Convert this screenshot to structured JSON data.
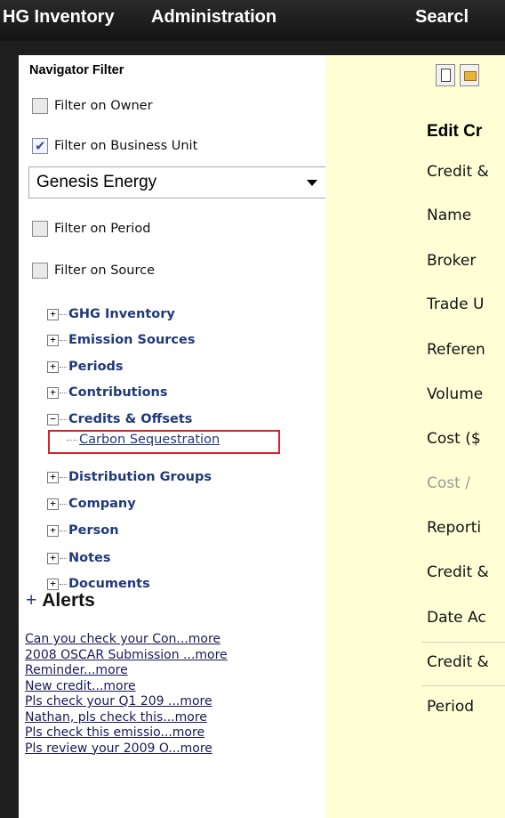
{
  "topnav": [
    "HG Inventory",
    "Administration",
    "Searcl"
  ],
  "navigator_filter": {
    "title": "Navigator Filter",
    "filters": [
      {
        "label": "Filter on Owner",
        "checked": false
      },
      {
        "label": "Filter on Business Unit",
        "checked": true
      },
      {
        "label": "Filter on Period",
        "checked": false
      },
      {
        "label": "Filter on Source",
        "checked": false
      }
    ],
    "business_unit_value": "Genesis Energy"
  },
  "tree": [
    {
      "label": "GHG Inventory",
      "expander": "+"
    },
    {
      "label": "Emission Sources",
      "expander": "+"
    },
    {
      "label": "Periods",
      "expander": "+"
    },
    {
      "label": "Contributions",
      "expander": "+"
    },
    {
      "label": "Credits & Offsets",
      "expander": "−"
    },
    {
      "label": "Carbon Sequestration",
      "child": true
    },
    {
      "label": "Distribution Groups",
      "expander": "+"
    },
    {
      "label": "Company",
      "expander": "+"
    },
    {
      "label": "Person",
      "expander": "+"
    },
    {
      "label": "Notes",
      "expander": "+"
    },
    {
      "label": "Documents",
      "expander": "+"
    }
  ],
  "alerts": {
    "title": "Alerts",
    "plus": "+",
    "items": [
      "Can you check your Con...more",
      "2008 OSCAR Submission ...more",
      "Reminder...more",
      "New credit...more",
      "Pls check your Q1 209 ...more",
      "Nathan, pls check this...more",
      "Pls check this emissio...more",
      "Pls review your 2009 O...more"
    ]
  },
  "edit_panel": {
    "title": "Edit Cr",
    "fields": [
      {
        "label": "Credit &",
        "muted": false
      },
      {
        "label": "Name",
        "muted": false
      },
      {
        "label": "Broker",
        "muted": false
      },
      {
        "label": "Trade U",
        "muted": false
      },
      {
        "label": "Referen",
        "muted": false
      },
      {
        "label": "Volume",
        "muted": false
      },
      {
        "label": "Cost ($",
        "muted": false
      },
      {
        "label": "Cost /",
        "muted": true
      },
      {
        "label": "Reporti",
        "muted": false
      },
      {
        "label": "Credit &",
        "muted": false
      },
      {
        "label": "Date Ac",
        "muted": false
      },
      {
        "label": "Credit &",
        "muted": false
      },
      {
        "label": "Period",
        "muted": false
      }
    ]
  },
  "colors": {
    "topbar": "#1e1e1e",
    "left_panel": "#ffffff",
    "right_panel": "#ffffd6",
    "tree_link": "#1f3a7a",
    "highlight": "#d9212e"
  }
}
